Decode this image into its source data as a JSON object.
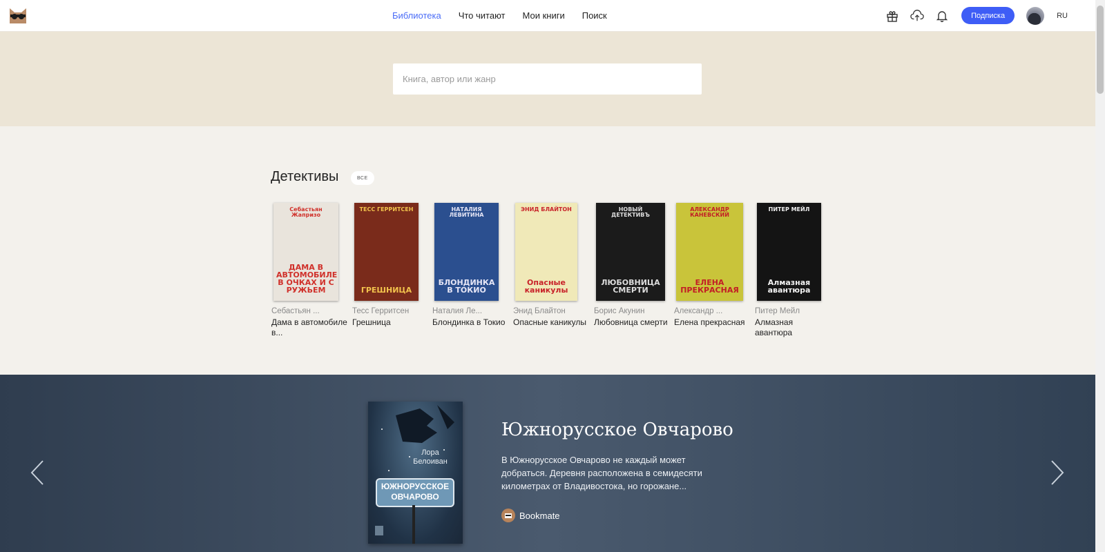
{
  "nav": {
    "items": [
      "Библиотека",
      "Что читают",
      "Мои книги",
      "Поиск"
    ],
    "active": "Библиотека"
  },
  "header": {
    "subscribe_label": "Подписка",
    "lang": "RU",
    "icons": [
      "gift-icon",
      "upload-cloud-icon",
      "bell-icon"
    ]
  },
  "search": {
    "placeholder": "Книга, автор или жанр"
  },
  "shelf": {
    "title": "Детективы",
    "all_label": "ВСЕ",
    "books": [
      {
        "author": "Себастьян ...",
        "title": "Дама в автомобиле в...",
        "cover_top": "Себастьян Жапризо",
        "cover_main": "ДАМА В АВТОМОБИЛЕ В ОЧКАХ И С РУЖЬЕМ",
        "colors": [
          "#e9e4dc",
          "#d0302a"
        ]
      },
      {
        "author": "Тесс Герритсен",
        "title": "Грешница",
        "cover_top": "ТЕСС ГЕРРИТСЕН",
        "cover_main": "ГРЕШНИЦА",
        "colors": [
          "#7a2b1b",
          "#f2c34d"
        ]
      },
      {
        "author": "Наталия Ле...",
        "title": "Блондинка в Токио",
        "cover_top": "НАТАЛИЯ ЛЕВИТИНА",
        "cover_main": "БЛОНДИНКА В ТОКИО",
        "colors": [
          "#2b4f8f",
          "#e6e6f6"
        ]
      },
      {
        "author": "Энид Блайтон",
        "title": "Опасные каникулы",
        "cover_top": "ЭНИД БЛАЙТОН",
        "cover_main": "Опасные каникулы",
        "colors": [
          "#f0e9b8",
          "#c8232a"
        ]
      },
      {
        "author": "Борис Акунин",
        "title": "Любовница смерти",
        "cover_top": "НОВЫЙ ДЕТЕКТИВЪ",
        "cover_main": "ЛЮБОВНИЦА СМЕРТИ",
        "colors": [
          "#1b1b1b",
          "#dddddd"
        ]
      },
      {
        "author": "Александр ...",
        "title": "Елена прекрасная",
        "cover_top": "АЛЕКСАНДР КАНЕВСКИЙ",
        "cover_main": "ЕЛЕНА ПРЕКРАСНАЯ",
        "colors": [
          "#c9c43a",
          "#c21d25"
        ]
      },
      {
        "author": "Питер Мейл",
        "title": "Алмазная авантюра",
        "cover_top": "ПИТЕР МЕЙЛ",
        "cover_main": "Алмазная авантюра",
        "colors": [
          "#141414",
          "#f2f2f2"
        ]
      }
    ]
  },
  "promo": {
    "title": "Южнорусское Овчарово",
    "description": "В Южнорусское Овчарово не каждый может добраться. Деревня расположена в семидесяти километрах от Владивостока, но горожане...",
    "brand": "Bookmate",
    "cover_author": "Лора Белоиван",
    "cover_title": "ЮЖНОРУССКОЕ ОВЧАРОВО"
  }
}
